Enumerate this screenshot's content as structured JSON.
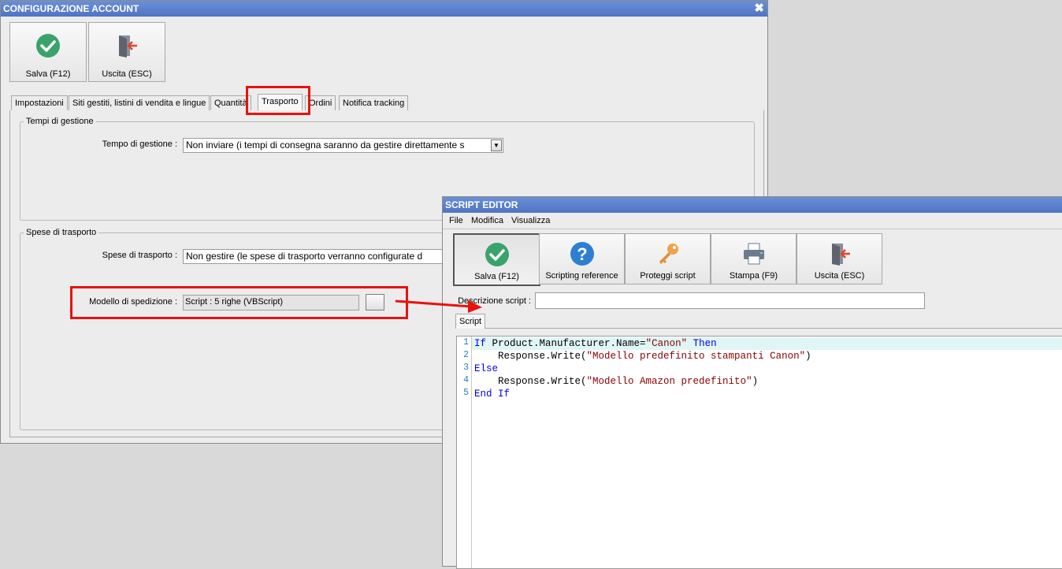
{
  "main_window": {
    "title": "CONFIGURAZIONE ACCOUNT",
    "close_glyph": "✖",
    "toolbar": {
      "save_label": "Salva (F12)",
      "exit_label": "Uscita (ESC)"
    },
    "tabs": [
      {
        "label": "Impostazioni"
      },
      {
        "label": "Siti gestiti, listini di vendita e lingue"
      },
      {
        "label": "Quantità"
      },
      {
        "label": "Trasporto",
        "active": true
      },
      {
        "label": "Ordini"
      },
      {
        "label": "Notifica tracking"
      }
    ],
    "group_times": {
      "title": "Tempi di gestione",
      "field_label": "Tempo di gestione :",
      "value": "Non inviare (i tempi di consegna saranno da gestire direttamente s"
    },
    "group_shipping": {
      "title": "Spese di trasporto",
      "field_label": "Spese di trasporto :",
      "value": "Non gestire (le spese di trasporto verranno configurate d",
      "model_label": "Modello di spedizione :",
      "model_value": "Script : 5 righe (VBScript)"
    }
  },
  "script_editor": {
    "title": "SCRIPT EDITOR",
    "menu": [
      "File",
      "Modifica",
      "Visualizza"
    ],
    "toolbar": [
      {
        "label": "Salva (F12)",
        "icon": "check-icon"
      },
      {
        "label": "Scripting reference",
        "icon": "help-icon"
      },
      {
        "label": "Proteggi script",
        "icon": "key-icon"
      },
      {
        "label": "Stampa (F9)",
        "icon": "printer-icon"
      },
      {
        "label": "Uscita (ESC)",
        "icon": "exit-door-icon"
      }
    ],
    "description_label": "Descrizione script :",
    "description_value": "",
    "tab_label": "Script",
    "line_numbers": [
      "1",
      "2",
      "3",
      "4",
      "5"
    ],
    "code_lines": [
      "If Product.Manufacturer.Name=\"Canon\" Then",
      "    Response.Write(\"Modello predefinito stampanti Canon\")",
      "Else",
      "    Response.Write(\"Modello Amazon predefinito\")",
      "End If"
    ]
  },
  "colors": {
    "highlight": "#e8120f",
    "title_bar": "#5a7fcf",
    "keyword": "#0000ee",
    "string": "#8b0000"
  }
}
